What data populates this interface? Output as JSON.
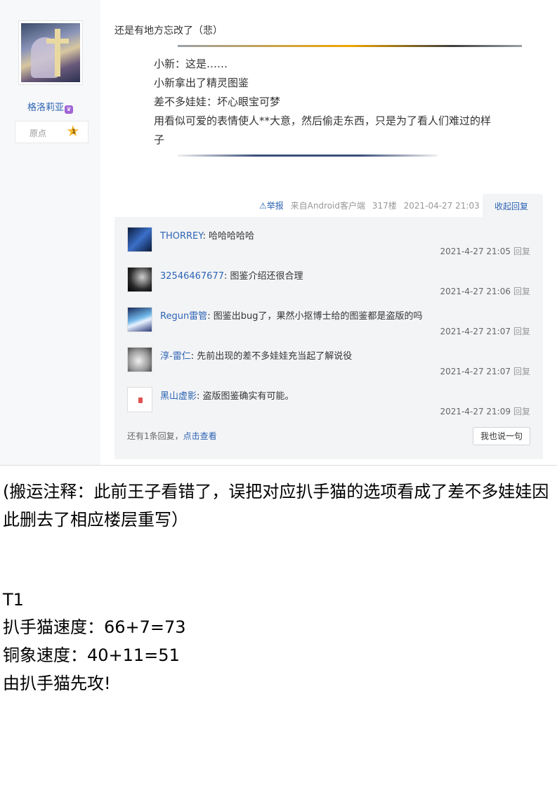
{
  "post": {
    "author": {
      "name": "格洛莉亚",
      "rank_label": "原点",
      "rank_level": "1"
    },
    "intro": "还是有地方忘改了（悲）",
    "quote_lines": [
      "小新：这是……",
      "小新拿出了精灵图鉴",
      "差不多娃娃：坏心眼宝可梦",
      "用看似可爱的表情使人**大意，然后偷走东西，只是为了看人们难过的样",
      "子"
    ],
    "meta": {
      "report": "举报",
      "client": "来自Android客户端",
      "floor": "317楼",
      "time": "2021-04-27 21:03",
      "collapse": "收起回复"
    },
    "replies": [
      {
        "name": "THORREY",
        "text": ": 哈哈哈哈哈",
        "time": "2021-4-27 21:05",
        "reply": "回复"
      },
      {
        "name": "32546467677",
        "text": ": 图鉴介绍还很合理",
        "time": "2021-4-27 21:06",
        "reply": "回复"
      },
      {
        "name": "Regun雷管",
        "text": ": 图鉴出bug了，果然小抠博士给的图鉴都是盗版的吗",
        "time": "2021-4-27 21:07",
        "reply": "回复"
      },
      {
        "name": "淳-雷仁",
        "text": ": 先前出现的差不多娃娃充当起了解说役",
        "time": "2021-4-27 21:07",
        "reply": "回复"
      },
      {
        "name": "黑山虚影",
        "text": ": 盗版图鉴确实有可能。",
        "time": "2021-4-27 21:09",
        "reply": "回复"
      }
    ],
    "more_replies": {
      "prefix": "还有1条回复，",
      "link": "点击查看"
    },
    "say_button": "我也说一句"
  },
  "note": "(搬运注释：此前王子看错了，误把对应扒手猫的选项看成了差不多娃娃因此删去了相应楼层重写）",
  "body_lines": [
    "T1",
    "扒手猫速度：66+7=73",
    "铜象速度：40+11=51",
    "由扒手猫先攻!"
  ]
}
